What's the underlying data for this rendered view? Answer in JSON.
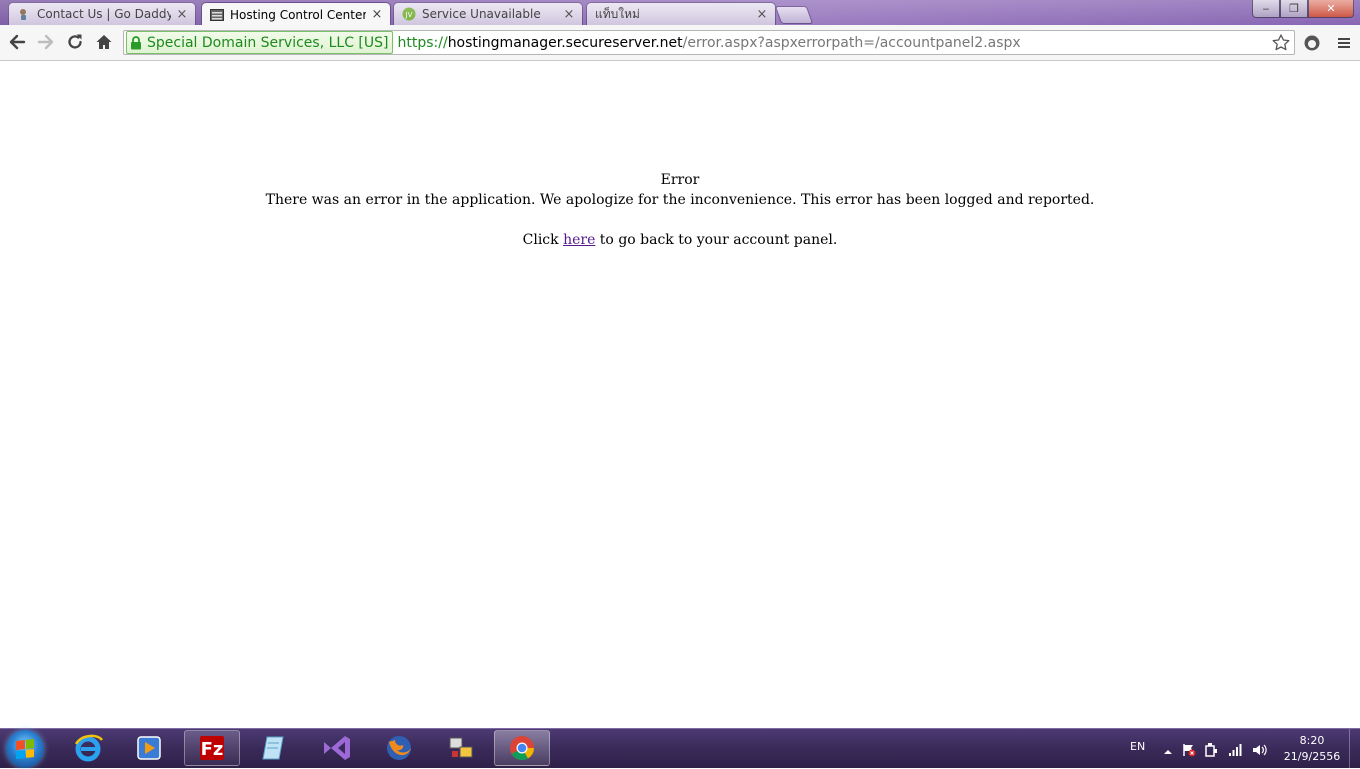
{
  "browser": {
    "tabs": [
      {
        "title": "Contact Us | Go Daddy Su",
        "favicon": "godaddy-icon",
        "active": false
      },
      {
        "title": "Hosting Control Center",
        "favicon": "page-icon",
        "active": true
      },
      {
        "title": "Service Unavailable",
        "favicon": "jv-icon",
        "active": false
      },
      {
        "title": "แท็บใหม่",
        "favicon": "",
        "active": false
      }
    ],
    "close_glyph": "×",
    "window_buttons": {
      "minimize": "‒",
      "maximize": "❐",
      "close": "✕"
    },
    "ev_certificate": "Special Domain Services, LLC [US]",
    "url": {
      "scheme": "https://",
      "host": "hostingmanager.secureserver.net",
      "path": "/error.aspx?aspxerrorpath=/accountpanel2.aspx"
    }
  },
  "page": {
    "heading": "Error",
    "message": "There was an error in the application. We apologize for the inconvenience. This error has been logged and reported.",
    "click_prefix": "Click ",
    "link_text": "here",
    "click_suffix": " to go back to your account panel."
  },
  "taskbar": {
    "apps": [
      "start",
      "internet-explorer",
      "media-player",
      "filezilla",
      "notepad",
      "visual-studio",
      "firefox",
      "network-tool",
      "chrome"
    ],
    "language": "EN",
    "time": "8:20",
    "date": "21/9/2556"
  },
  "colors": {
    "ev_green": "#1e8a1e",
    "link_visited": "#551a8b",
    "titlebar": "#8e6cb4",
    "taskbar": "#3a2a5a"
  }
}
